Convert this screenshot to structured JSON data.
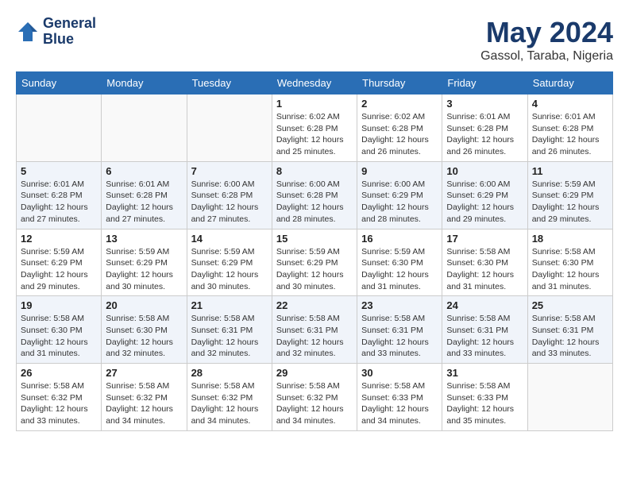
{
  "header": {
    "logo_line1": "General",
    "logo_line2": "Blue",
    "month": "May 2024",
    "location": "Gassol, Taraba, Nigeria"
  },
  "days_of_week": [
    "Sunday",
    "Monday",
    "Tuesday",
    "Wednesday",
    "Thursday",
    "Friday",
    "Saturday"
  ],
  "weeks": [
    {
      "alt": false,
      "days": [
        {
          "num": "",
          "info": ""
        },
        {
          "num": "",
          "info": ""
        },
        {
          "num": "",
          "info": ""
        },
        {
          "num": "1",
          "info": "Sunrise: 6:02 AM\nSunset: 6:28 PM\nDaylight: 12 hours\nand 25 minutes."
        },
        {
          "num": "2",
          "info": "Sunrise: 6:02 AM\nSunset: 6:28 PM\nDaylight: 12 hours\nand 26 minutes."
        },
        {
          "num": "3",
          "info": "Sunrise: 6:01 AM\nSunset: 6:28 PM\nDaylight: 12 hours\nand 26 minutes."
        },
        {
          "num": "4",
          "info": "Sunrise: 6:01 AM\nSunset: 6:28 PM\nDaylight: 12 hours\nand 26 minutes."
        }
      ]
    },
    {
      "alt": true,
      "days": [
        {
          "num": "5",
          "info": "Sunrise: 6:01 AM\nSunset: 6:28 PM\nDaylight: 12 hours\nand 27 minutes."
        },
        {
          "num": "6",
          "info": "Sunrise: 6:01 AM\nSunset: 6:28 PM\nDaylight: 12 hours\nand 27 minutes."
        },
        {
          "num": "7",
          "info": "Sunrise: 6:00 AM\nSunset: 6:28 PM\nDaylight: 12 hours\nand 27 minutes."
        },
        {
          "num": "8",
          "info": "Sunrise: 6:00 AM\nSunset: 6:28 PM\nDaylight: 12 hours\nand 28 minutes."
        },
        {
          "num": "9",
          "info": "Sunrise: 6:00 AM\nSunset: 6:29 PM\nDaylight: 12 hours\nand 28 minutes."
        },
        {
          "num": "10",
          "info": "Sunrise: 6:00 AM\nSunset: 6:29 PM\nDaylight: 12 hours\nand 29 minutes."
        },
        {
          "num": "11",
          "info": "Sunrise: 5:59 AM\nSunset: 6:29 PM\nDaylight: 12 hours\nand 29 minutes."
        }
      ]
    },
    {
      "alt": false,
      "days": [
        {
          "num": "12",
          "info": "Sunrise: 5:59 AM\nSunset: 6:29 PM\nDaylight: 12 hours\nand 29 minutes."
        },
        {
          "num": "13",
          "info": "Sunrise: 5:59 AM\nSunset: 6:29 PM\nDaylight: 12 hours\nand 30 minutes."
        },
        {
          "num": "14",
          "info": "Sunrise: 5:59 AM\nSunset: 6:29 PM\nDaylight: 12 hours\nand 30 minutes."
        },
        {
          "num": "15",
          "info": "Sunrise: 5:59 AM\nSunset: 6:29 PM\nDaylight: 12 hours\nand 30 minutes."
        },
        {
          "num": "16",
          "info": "Sunrise: 5:59 AM\nSunset: 6:30 PM\nDaylight: 12 hours\nand 31 minutes."
        },
        {
          "num": "17",
          "info": "Sunrise: 5:58 AM\nSunset: 6:30 PM\nDaylight: 12 hours\nand 31 minutes."
        },
        {
          "num": "18",
          "info": "Sunrise: 5:58 AM\nSunset: 6:30 PM\nDaylight: 12 hours\nand 31 minutes."
        }
      ]
    },
    {
      "alt": true,
      "days": [
        {
          "num": "19",
          "info": "Sunrise: 5:58 AM\nSunset: 6:30 PM\nDaylight: 12 hours\nand 31 minutes."
        },
        {
          "num": "20",
          "info": "Sunrise: 5:58 AM\nSunset: 6:30 PM\nDaylight: 12 hours\nand 32 minutes."
        },
        {
          "num": "21",
          "info": "Sunrise: 5:58 AM\nSunset: 6:31 PM\nDaylight: 12 hours\nand 32 minutes."
        },
        {
          "num": "22",
          "info": "Sunrise: 5:58 AM\nSunset: 6:31 PM\nDaylight: 12 hours\nand 32 minutes."
        },
        {
          "num": "23",
          "info": "Sunrise: 5:58 AM\nSunset: 6:31 PM\nDaylight: 12 hours\nand 33 minutes."
        },
        {
          "num": "24",
          "info": "Sunrise: 5:58 AM\nSunset: 6:31 PM\nDaylight: 12 hours\nand 33 minutes."
        },
        {
          "num": "25",
          "info": "Sunrise: 5:58 AM\nSunset: 6:31 PM\nDaylight: 12 hours\nand 33 minutes."
        }
      ]
    },
    {
      "alt": false,
      "days": [
        {
          "num": "26",
          "info": "Sunrise: 5:58 AM\nSunset: 6:32 PM\nDaylight: 12 hours\nand 33 minutes."
        },
        {
          "num": "27",
          "info": "Sunrise: 5:58 AM\nSunset: 6:32 PM\nDaylight: 12 hours\nand 34 minutes."
        },
        {
          "num": "28",
          "info": "Sunrise: 5:58 AM\nSunset: 6:32 PM\nDaylight: 12 hours\nand 34 minutes."
        },
        {
          "num": "29",
          "info": "Sunrise: 5:58 AM\nSunset: 6:32 PM\nDaylight: 12 hours\nand 34 minutes."
        },
        {
          "num": "30",
          "info": "Sunrise: 5:58 AM\nSunset: 6:33 PM\nDaylight: 12 hours\nand 34 minutes."
        },
        {
          "num": "31",
          "info": "Sunrise: 5:58 AM\nSunset: 6:33 PM\nDaylight: 12 hours\nand 35 minutes."
        },
        {
          "num": "",
          "info": ""
        }
      ]
    }
  ]
}
